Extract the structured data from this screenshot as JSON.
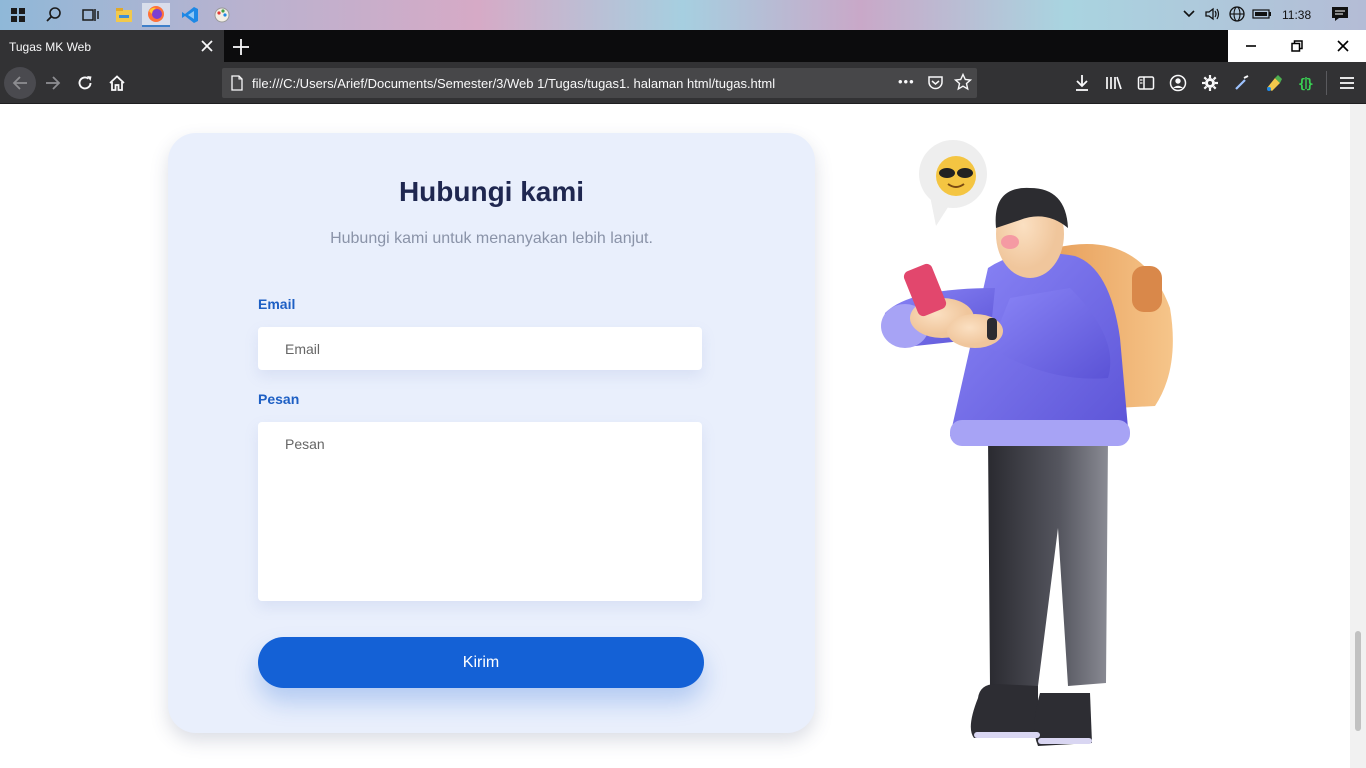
{
  "taskbar": {
    "apps": [
      {
        "name": "start-icon"
      },
      {
        "name": "search-icon"
      },
      {
        "name": "task-view-icon"
      },
      {
        "name": "file-explorer-icon"
      },
      {
        "name": "firefox-icon"
      },
      {
        "name": "vscode-icon"
      },
      {
        "name": "paint-icon"
      }
    ],
    "clock": "11:38"
  },
  "browser": {
    "tab_title": "Tugas MK Web",
    "url": "file:///C:/Users/Arief/Documents/Semester/3/Web 1/Tugas/tugas1. halaman html/tugas.html",
    "url_more": "•••"
  },
  "contact_form": {
    "title": "Hubungi kami",
    "subtitle": "Hubungi kami untuk menanyakan lebih lanjut.",
    "email_label": "Email",
    "email_placeholder": "Email",
    "email_value": "",
    "message_label": "Pesan",
    "message_placeholder": "Pesan",
    "message_value": "",
    "submit_label": "Kirim"
  },
  "colors": {
    "primary": "#1461d6",
    "card_background": "#e9effc",
    "title": "#1f2750",
    "label": "#1d5fc4"
  }
}
